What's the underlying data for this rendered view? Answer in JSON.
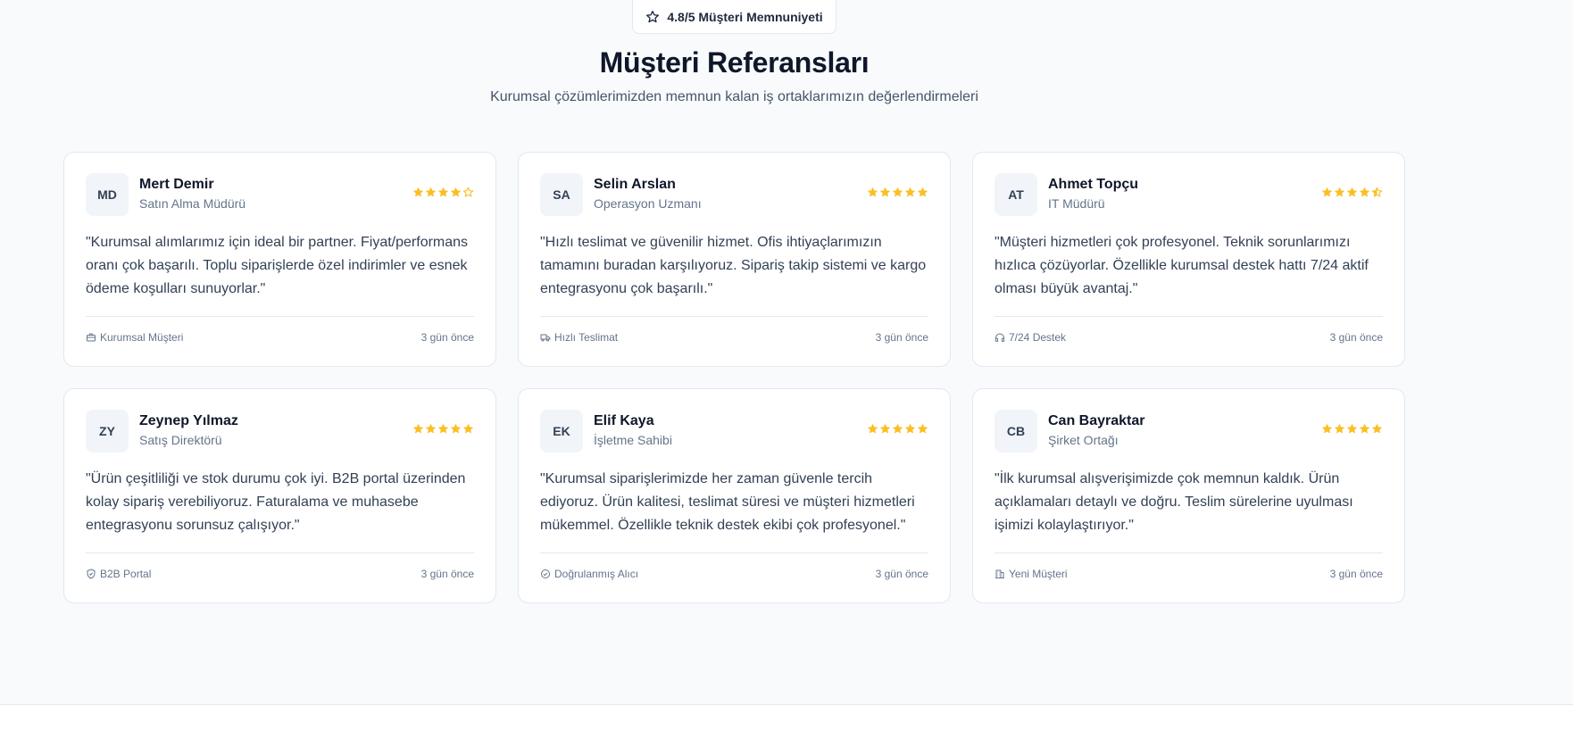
{
  "badge": {
    "text": "4.8/5 Müşteri Memnuniyeti",
    "icon": "star-outline-icon"
  },
  "header": {
    "title": "Müşteri Referansları",
    "subtitle": "Kurumsal çözümlerimizden memnun kalan iş ortaklarımızın değerlendirmeleri"
  },
  "colors": {
    "star": "#fbbf24",
    "star_empty": "#fbbf24",
    "card_border": "#e2e8f0",
    "avatar_bg": "#f1f5f9"
  },
  "testimonials": [
    {
      "initials": "MD",
      "name": "Mert Demir",
      "role": "Satın Alma Müdürü",
      "rating": 4,
      "quote": "\"Kurumsal alımlarımız için ideal bir partner. Fiyat/performans oranı çok başarılı. Toplu siparişlerde özel indirimler ve esnek ödeme koşulları sunuyorlar.\"",
      "tag": "Kurumsal Müşteri",
      "tag_icon": "briefcase-icon",
      "time": "3 gün önce"
    },
    {
      "initials": "SA",
      "name": "Selin Arslan",
      "role": "Operasyon Uzmanı",
      "rating": 5,
      "quote": "\"Hızlı teslimat ve güvenilir hizmet. Ofis ihtiyaçlarımızın tamamını buradan karşılıyoruz. Sipariş takip sistemi ve kargo entegrasyonu çok başarılı.\"",
      "tag": "Hızlı Teslimat",
      "tag_icon": "truck-icon",
      "time": "3 gün önce"
    },
    {
      "initials": "AT",
      "name": "Ahmet Topçu",
      "role": "IT Müdürü",
      "rating": 4.5,
      "quote": "\"Müşteri hizmetleri çok profesyonel. Teknik sorunlarımızı hızlıca çözüyorlar. Özellikle kurumsal destek hattı 7/24 aktif olması büyük avantaj.\"",
      "tag": "7/24 Destek",
      "tag_icon": "headphones-icon",
      "time": "3 gün önce"
    },
    {
      "initials": "ZY",
      "name": "Zeynep Yılmaz",
      "role": "Satış Direktörü",
      "rating": 5,
      "quote": "\"Ürün çeşitliliği ve stok durumu çok iyi. B2B portal üzerinden kolay sipariş verebiliyoruz. Faturalama ve muhasebe entegrasyonu sorunsuz çalışıyor.\"",
      "tag": "B2B Portal",
      "tag_icon": "shield-check-icon",
      "time": "3 gün önce"
    },
    {
      "initials": "EK",
      "name": "Elif Kaya",
      "role": "İşletme Sahibi",
      "rating": 5,
      "quote": "\"Kurumsal siparişlerimizde her zaman güvenle tercih ediyoruz. Ürün kalitesi, teslimat süresi ve müşteri hizmetleri mükemmel. Özellikle teknik destek ekibi çok profesyonel.\"",
      "tag": "Doğrulanmış Alıcı",
      "tag_icon": "check-circle-icon",
      "time": "3 gün önce"
    },
    {
      "initials": "CB",
      "name": "Can Bayraktar",
      "role": "Şirket Ortağı",
      "rating": 5,
      "quote": "\"İlk kurumsal alışverişimizde çok memnun kaldık. Ürün açıklamaları detaylı ve doğru. Teslim sürelerine uyulması işimizi kolaylaştırıyor.\"",
      "tag": "Yeni Müşteri",
      "tag_icon": "building-icon",
      "time": "3 gün önce"
    }
  ]
}
